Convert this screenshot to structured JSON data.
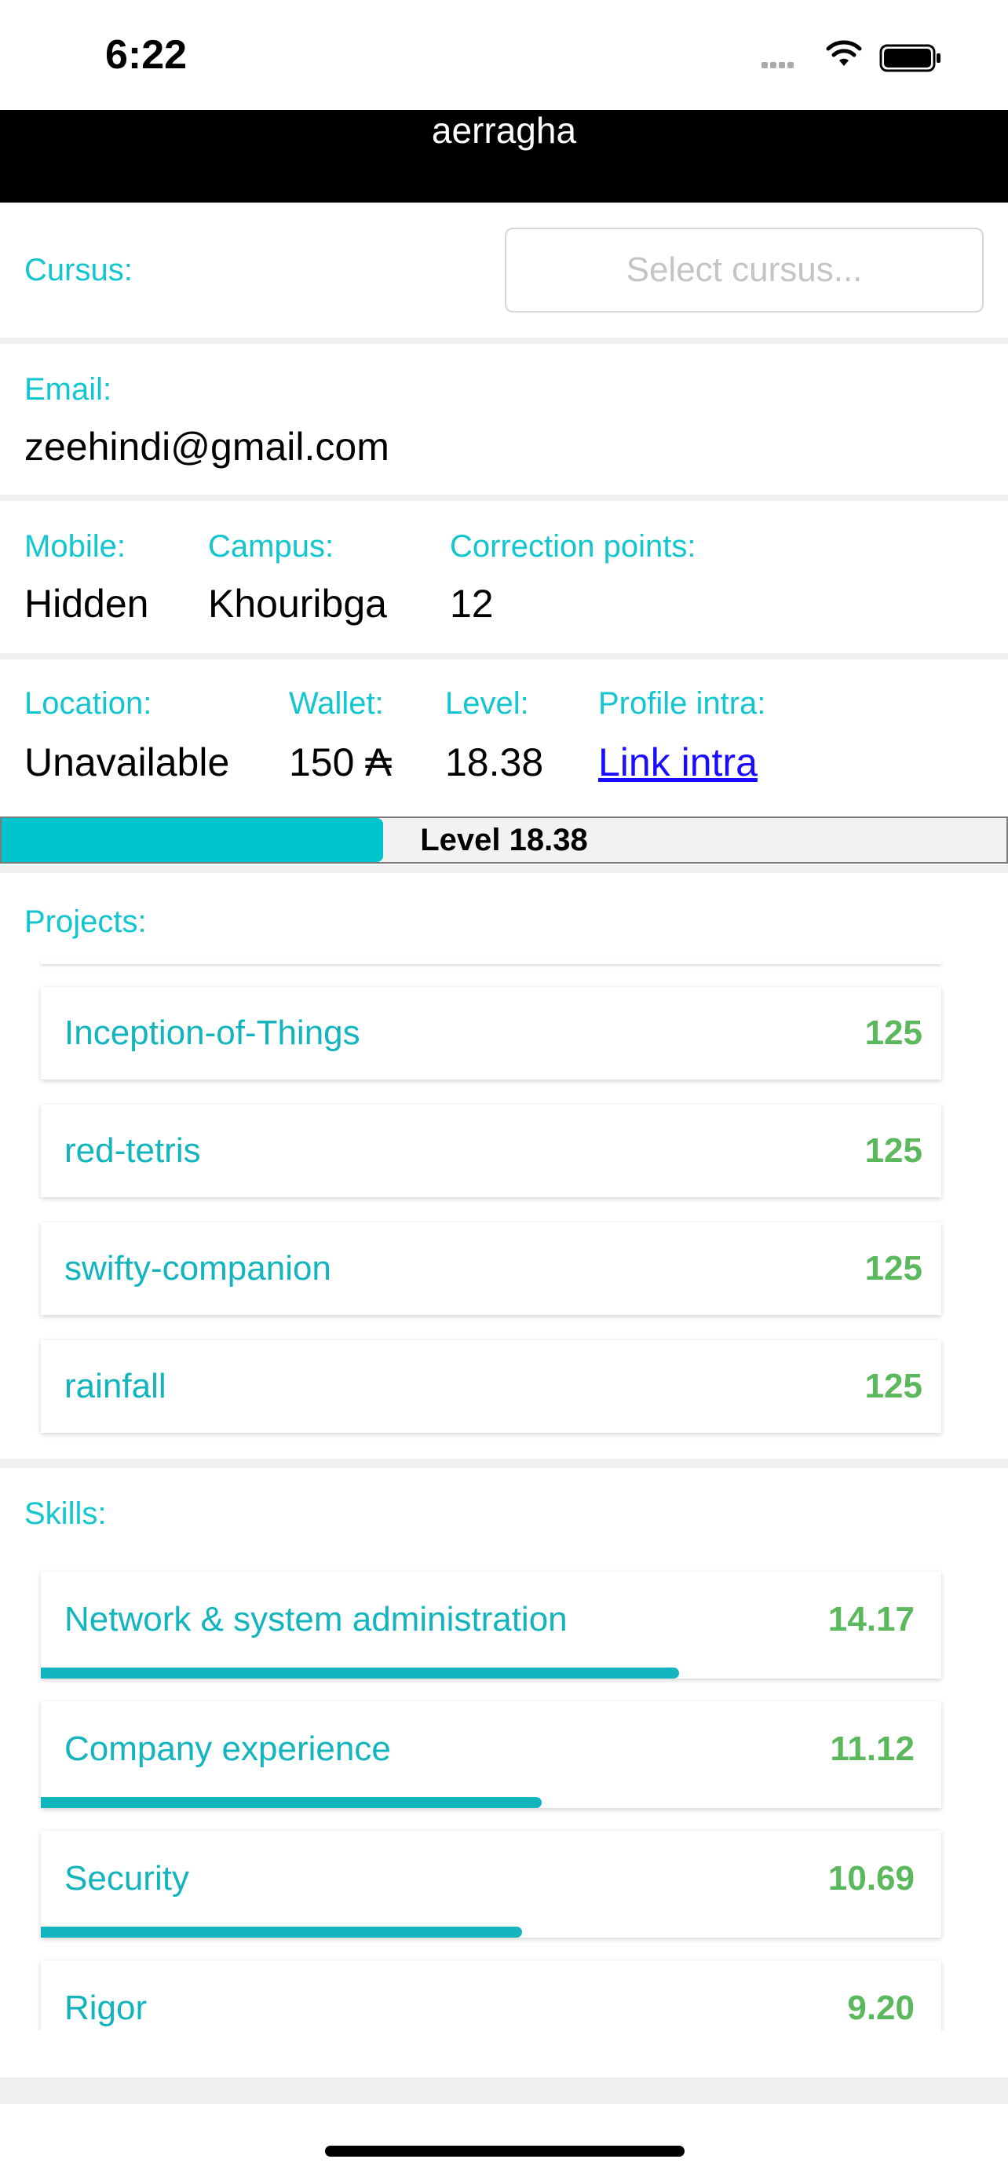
{
  "status_bar": {
    "time": "6:22"
  },
  "header": {
    "title": "aerragha"
  },
  "cursus": {
    "label": "Cursus:",
    "placeholder": "Select cursus..."
  },
  "email": {
    "label": "Email:",
    "value": "zeehindi@gmail.com"
  },
  "row1": {
    "mobile_label": "Mobile:",
    "mobile_value": "Hidden",
    "campus_label": "Campus:",
    "campus_value": "Khouribga",
    "correction_label": "Correction points:",
    "correction_value": "12"
  },
  "row2": {
    "location_label": "Location:",
    "location_value": "Unavailable",
    "wallet_label": "Wallet:",
    "wallet_value": "150 ₳",
    "level_label": "Level:",
    "level_value": "18.38",
    "profile_label": "Profile intra:",
    "profile_link": "Link intra"
  },
  "level_bar": {
    "label": "Level 18.38",
    "progress": 0.38
  },
  "projects": {
    "label": "Projects:",
    "items": [
      {
        "name": "Inception-of-Things",
        "score": "125"
      },
      {
        "name": "red-tetris",
        "score": "125"
      },
      {
        "name": "swifty-companion",
        "score": "125"
      },
      {
        "name": "rainfall",
        "score": "125"
      }
    ]
  },
  "skills": {
    "label": "Skills:",
    "items": [
      {
        "name": "Network & system administration",
        "score": "14.17"
      },
      {
        "name": "Company experience",
        "score": "11.12"
      },
      {
        "name": "Security",
        "score": "10.69"
      },
      {
        "name": "Rigor",
        "score": "9.20"
      }
    ]
  },
  "colors": {
    "accent": "#12c6cf",
    "score": "#5cb85c",
    "header": "#000000",
    "link": "#1a0dff"
  }
}
